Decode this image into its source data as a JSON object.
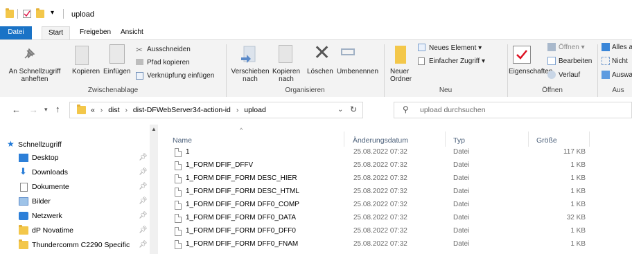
{
  "window": {
    "title": "upload"
  },
  "ribbon_tabs": [
    "Datei",
    "Start",
    "Freigeben",
    "Ansicht"
  ],
  "ribbon": {
    "clipboard": {
      "pin_quick_access": "An Schnellzugriff\nanheften",
      "copy": "Kopieren",
      "paste": "Einfügen",
      "cut": "Ausschneiden",
      "copy_path": "Pfad kopieren",
      "paste_shortcut": "Verknüpfung einfügen",
      "label": "Zwischenablage"
    },
    "organize": {
      "move_to": "Verschieben\nnach",
      "copy_to": "Kopieren\nnach",
      "delete": "Löschen",
      "rename": "Umbenennen",
      "label": "Organisieren"
    },
    "new": {
      "new_folder": "Neuer\nOrdner",
      "new_item": "Neues Element",
      "easy_access": "Einfacher Zugriff",
      "label": "Neu"
    },
    "open": {
      "properties": "Eigenschaften",
      "open": "Öffnen",
      "edit": "Bearbeiten",
      "history": "Verlauf",
      "label": "Öffnen"
    },
    "select": {
      "select_all": "Alles a",
      "select_none": "Nicht",
      "invert": "Auswa",
      "label": "Aus"
    }
  },
  "address": {
    "crumbs": [
      "«",
      "dist",
      "dist-DFWebServer34-action-id",
      "upload"
    ],
    "search_placeholder": "upload durchsuchen"
  },
  "nav": [
    {
      "label": "Schnellzugriff",
      "icon": "star-icon",
      "pinned": false,
      "indent": 0
    },
    {
      "label": "Desktop",
      "icon": "desktop-icon",
      "pinned": true,
      "indent": 1
    },
    {
      "label": "Downloads",
      "icon": "download-icon",
      "pinned": true,
      "indent": 1
    },
    {
      "label": "Dokumente",
      "icon": "document-icon",
      "pinned": true,
      "indent": 1
    },
    {
      "label": "Bilder",
      "icon": "pictures-icon",
      "pinned": true,
      "indent": 1
    },
    {
      "label": "Netzwerk",
      "icon": "network-icon",
      "pinned": true,
      "indent": 1
    },
    {
      "label": "dP Novatime",
      "icon": "folder-icon",
      "pinned": true,
      "indent": 1
    },
    {
      "label": "Thundercomm C2290 Specific",
      "icon": "folder-icon",
      "pinned": true,
      "indent": 1
    }
  ],
  "columns": {
    "name": "Name",
    "date": "Änderungsdatum",
    "type": "Typ",
    "size": "Größe"
  },
  "files": [
    {
      "name": "1",
      "date": "25.08.2022 07:32",
      "type": "Datei",
      "size": "117 KB"
    },
    {
      "name": "1_FORM DFIF_DFFV",
      "date": "25.08.2022 07:32",
      "type": "Datei",
      "size": "1 KB"
    },
    {
      "name": "1_FORM DFIF_FORM DESC_HIER",
      "date": "25.08.2022 07:32",
      "type": "Datei",
      "size": "1 KB"
    },
    {
      "name": "1_FORM DFIF_FORM DESC_HTML",
      "date": "25.08.2022 07:32",
      "type": "Datei",
      "size": "1 KB"
    },
    {
      "name": "1_FORM DFIF_FORM DFF0_COMP",
      "date": "25.08.2022 07:32",
      "type": "Datei",
      "size": "1 KB"
    },
    {
      "name": "1_FORM DFIF_FORM DFF0_DATA",
      "date": "25.08.2022 07:32",
      "type": "Datei",
      "size": "32 KB"
    },
    {
      "name": "1_FORM DFIF_FORM DFF0_DFF0",
      "date": "25.08.2022 07:32",
      "type": "Datei",
      "size": "1 KB"
    },
    {
      "name": "1_FORM DFIF_FORM DFF0_FNAM",
      "date": "25.08.2022 07:32",
      "type": "Datei",
      "size": "1 KB"
    }
  ],
  "colors": {
    "file_tab": "#1a73c6",
    "folder": "#f3c74a",
    "ribbon_bg": "#f3f3f3",
    "header_text": "#4c607a"
  }
}
